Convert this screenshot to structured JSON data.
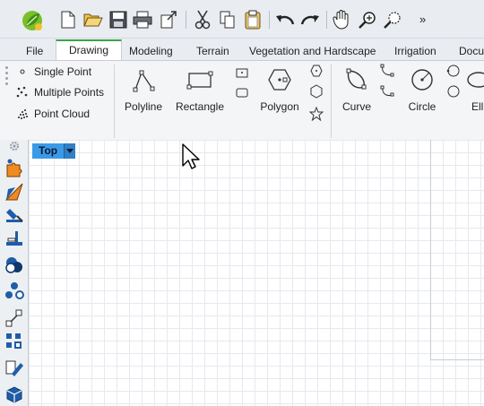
{
  "toolbar": {
    "icons": [
      "app-logo",
      "new-icon",
      "open-icon",
      "save-icon",
      "print-icon",
      "export-icon",
      "cut-icon",
      "copy-icon",
      "paste-icon",
      "undo-icon",
      "redo-icon",
      "pan-icon",
      "zoom-icon",
      "zoom-window-icon"
    ],
    "more_label": "»"
  },
  "tabs": [
    "File",
    "Drawing",
    "Modeling",
    "Terrain",
    "Vegetation and Hardscape",
    "Irrigation",
    "Docu"
  ],
  "ribbon": {
    "points": [
      "Single Point",
      "Multiple Points",
      "Point Cloud"
    ],
    "buttons": [
      "Polyline",
      "Rectangle",
      "Polygon",
      "Curve",
      "Circle",
      "Elli"
    ]
  },
  "viewport": {
    "label": "Top"
  },
  "colors": {
    "accent": "#3aa54c",
    "viewport_tab": "#3b9ae8"
  }
}
